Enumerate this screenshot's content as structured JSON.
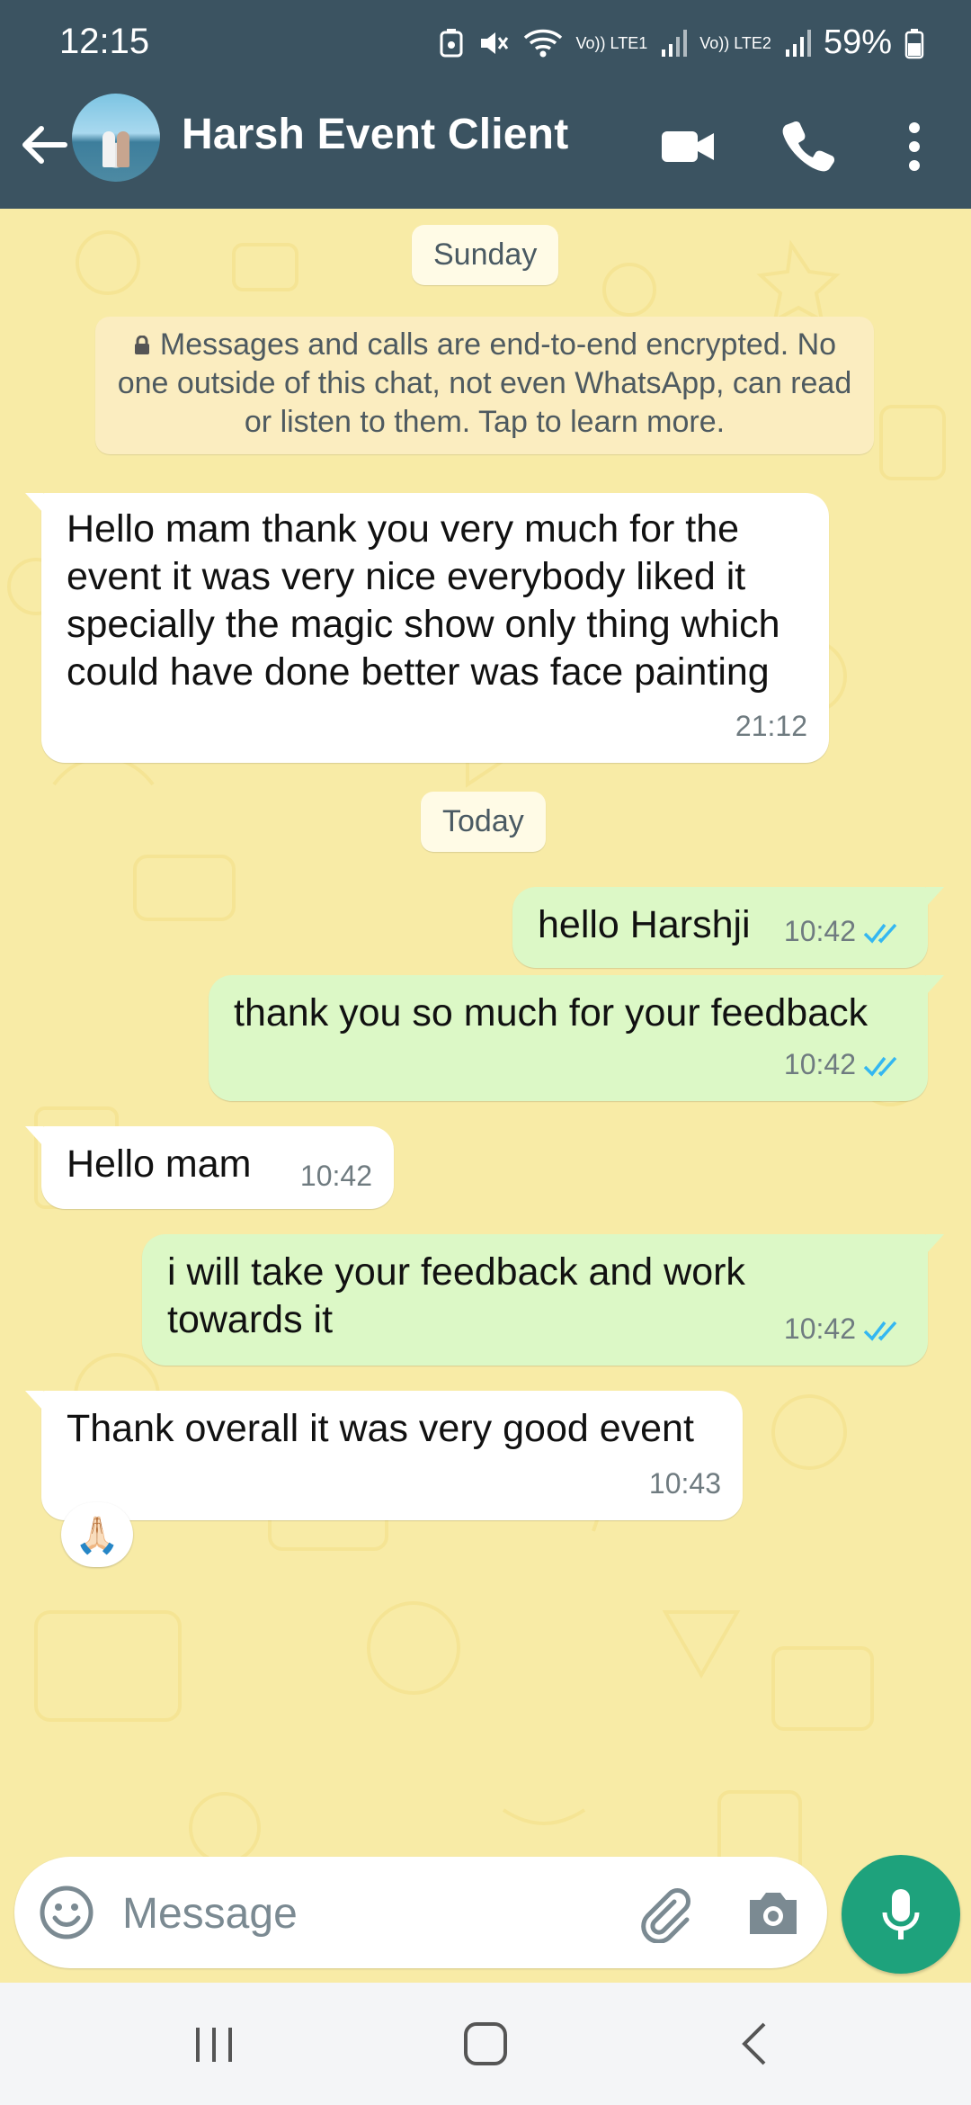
{
  "status_bar": {
    "time": "12:15",
    "battery": "59%",
    "sim1": "Vo)) LTE1",
    "sim2": "Vo)) LTE2"
  },
  "header": {
    "contact_name": "Harsh Event Client",
    "icons": [
      "back-arrow-icon",
      "video-call-icon",
      "voice-call-icon",
      "more-options-icon"
    ]
  },
  "chat": {
    "date_sunday": "Sunday",
    "encryption_notice": "Messages and calls are end-to-end encrypted. No one outside of this chat, not even WhatsApp, can read or listen to them. Tap to learn more.",
    "date_today": "Today",
    "messages": [
      {
        "direction": "incoming",
        "text": "Hello mam thank you very much for the event it was very nice everybody liked it specially the magic show only thing which could have done better was face painting",
        "time": "21:12"
      },
      {
        "direction": "outgoing",
        "text": "hello Harshji",
        "time": "10:42",
        "status": "read"
      },
      {
        "direction": "outgoing",
        "text": "thank you so much for your feedback",
        "time": "10:42",
        "status": "read"
      },
      {
        "direction": "incoming",
        "text": "Hello mam",
        "time": "10:42"
      },
      {
        "direction": "outgoing",
        "text": "i will take your feedback and work towards it",
        "time": "10:42",
        "status": "read"
      },
      {
        "direction": "incoming",
        "text": "Thank overall it was very good event",
        "time": "10:43",
        "reaction": "🙏🏻"
      }
    ]
  },
  "composer": {
    "placeholder": "Message",
    "icons": [
      "emoji-icon",
      "attach-icon",
      "camera-icon",
      "mic-icon"
    ]
  },
  "colors": {
    "header_bg": "#3b5361",
    "chat_bg": "#f8eba6",
    "outgoing_bubble": "#dcf8c6",
    "incoming_bubble": "#ffffff",
    "read_ticks": "#34b7f1",
    "mic_button": "#1ea27c"
  }
}
